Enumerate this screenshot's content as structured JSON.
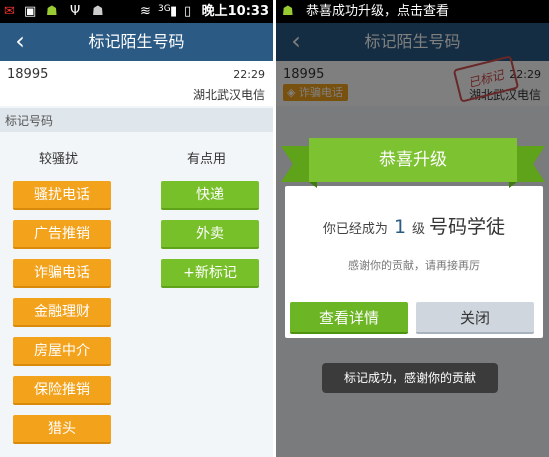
{
  "left": {
    "status": {
      "time": "晚上10:33",
      "signal_label": "3G"
    },
    "title": "标记陌生号码",
    "caller": {
      "number": "18995",
      "time": "22:29",
      "location": "湖北武汉电信"
    },
    "section_title": "标记号码",
    "col_annoying": "较骚扰",
    "col_useful": "有点用",
    "annoying_tags": [
      "骚扰电话",
      "广告推销",
      "诈骗电话",
      "金融理财",
      "房屋中介",
      "保险推销",
      "猎头"
    ],
    "useful_tags": [
      "快递",
      "外卖",
      "+新标记"
    ]
  },
  "right": {
    "status": {
      "notification": "恭喜成功升级，点击查看"
    },
    "title": "标记陌生号码",
    "caller": {
      "number": "18995",
      "time": "22:29",
      "location": "湖北武汉电信",
      "badge": "诈骗电话",
      "stamp": "已标记"
    },
    "dialog": {
      "banner": "恭喜升级",
      "prefix": "你已经成为",
      "level": "1",
      "level_unit": "级",
      "rank_title": "号码学徒",
      "thanks": "感谢你的贡献，请再接再厉",
      "detail_button": "查看详情",
      "close_button": "关闭"
    },
    "toast": "标记成功，感谢你的贡献"
  },
  "colors": {
    "titlebar": "#2b5a84",
    "orange": "#f3a21c",
    "green": "#78c02a"
  },
  "icons": [
    "notification-app-icon",
    "usb-icon",
    "wifi-icon",
    "signal-icon",
    "battery-icon",
    "back-arrow-icon",
    "shield-icon"
  ]
}
